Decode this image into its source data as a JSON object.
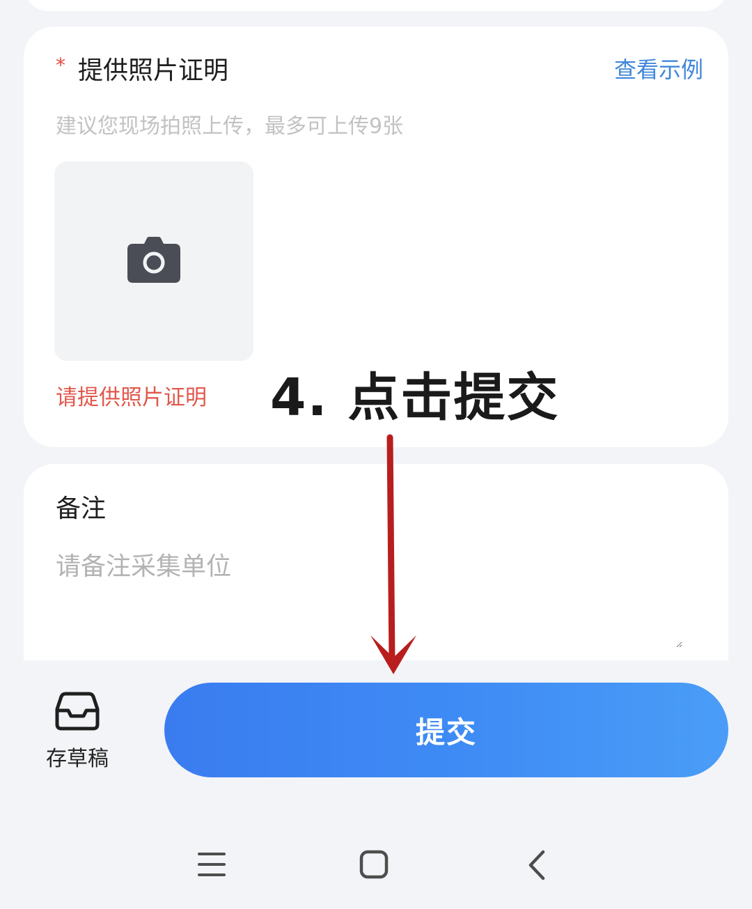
{
  "photo_section": {
    "required_mark": "*",
    "title": "提供照片证明",
    "example_link": "查看示例",
    "hint": "建议您现场拍照上传，最多可上传9张",
    "upload_icon": "camera-icon",
    "error": "请提供照片证明"
  },
  "annotation": {
    "text": "4. 点击提交",
    "arrow_color": "#b81e1e"
  },
  "remark_section": {
    "title": "备注",
    "placeholder": "请备注采集单位",
    "value": ""
  },
  "bottom_bar": {
    "draft_label": "存草稿",
    "draft_icon": "inbox-icon",
    "submit_label": "提交",
    "submit_color": "#3f8cf5"
  },
  "nav": {
    "menu_icon": "menu-icon",
    "home_icon": "home-icon",
    "back_icon": "back-icon"
  },
  "colors": {
    "accent": "#3f86db",
    "error": "#e0584c",
    "required": "#e5483d",
    "background": "#f3f4f7"
  }
}
